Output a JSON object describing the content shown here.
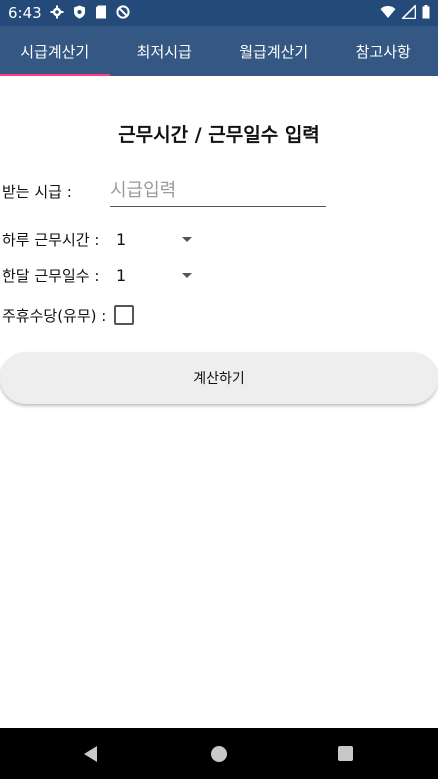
{
  "status_bar": {
    "time": "6:43",
    "left_icons": [
      "gear-icon",
      "shield-icon",
      "sd-card-icon",
      "sync-icon"
    ],
    "right_icons": [
      "wifi-icon",
      "signal-icon",
      "battery-icon"
    ]
  },
  "tabs": [
    {
      "label": "시급계산기",
      "active": true
    },
    {
      "label": "최저시급",
      "active": false
    },
    {
      "label": "월급계산기",
      "active": false
    },
    {
      "label": "참고사항",
      "active": false
    }
  ],
  "form": {
    "heading": "근무시간 / 근무일수 입력",
    "wage": {
      "label": "받는 시급 :",
      "placeholder": "시급입력",
      "value": ""
    },
    "daily_hours": {
      "label": "하루 근무시간 :",
      "value": "1"
    },
    "monthly_days": {
      "label": "한달 근무일수 :",
      "value": "1"
    },
    "weekly_allowance": {
      "label": "주휴수당(유무) :",
      "checked": false
    },
    "calculate_button": "계산하기"
  },
  "colors": {
    "status_bar": "#234a78",
    "tab_bar": "#345784",
    "tab_indicator": "#ff3b82"
  }
}
